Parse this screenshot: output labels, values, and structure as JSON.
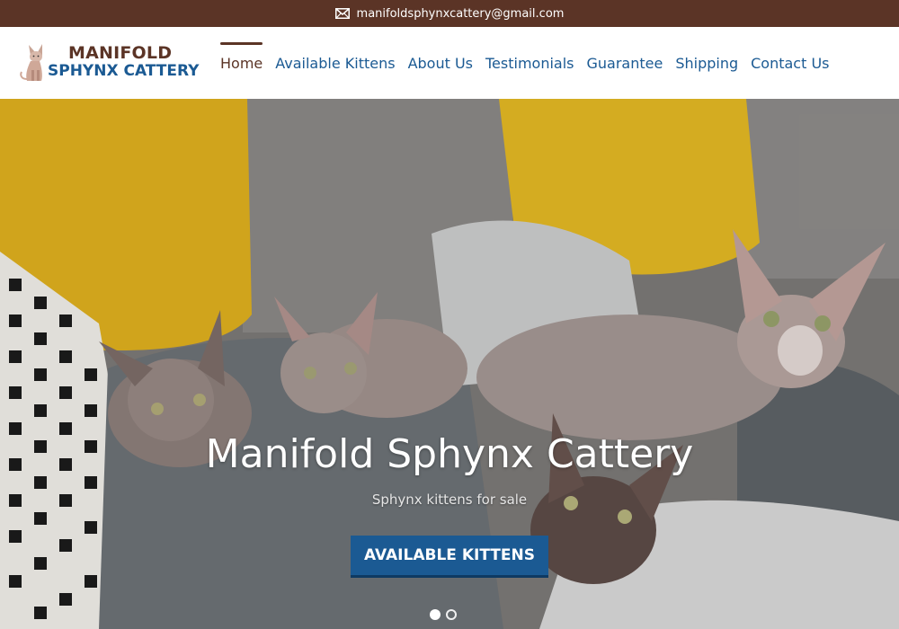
{
  "topbar": {
    "email": "manifoldsphynxcattery@gmail.com",
    "icon": "mail-icon",
    "bg_color": "#5b3426"
  },
  "logo": {
    "line1": "MANIFOLD",
    "line2": "SPHYNX CATTERY",
    "icon": "sphynx-cat-logo-icon"
  },
  "nav": {
    "items": [
      {
        "label": "Home",
        "active": true
      },
      {
        "label": "Available Kittens",
        "active": false
      },
      {
        "label": "About Us",
        "active": false
      },
      {
        "label": "Testimonials",
        "active": false
      },
      {
        "label": "Guarantee",
        "active": false
      },
      {
        "label": "Shipping",
        "active": false
      },
      {
        "label": "Contact Us",
        "active": false
      }
    ],
    "link_color": "#1b5a93",
    "active_color": "#5b3426"
  },
  "hero": {
    "title": "Manifold Sphynx Cattery",
    "subtitle": "Sphynx kittens for sale",
    "button_label": "AVAILABLE KITTENS",
    "button_color": "#1b5a93",
    "slides": [
      {
        "active": true
      },
      {
        "active": false
      }
    ]
  }
}
